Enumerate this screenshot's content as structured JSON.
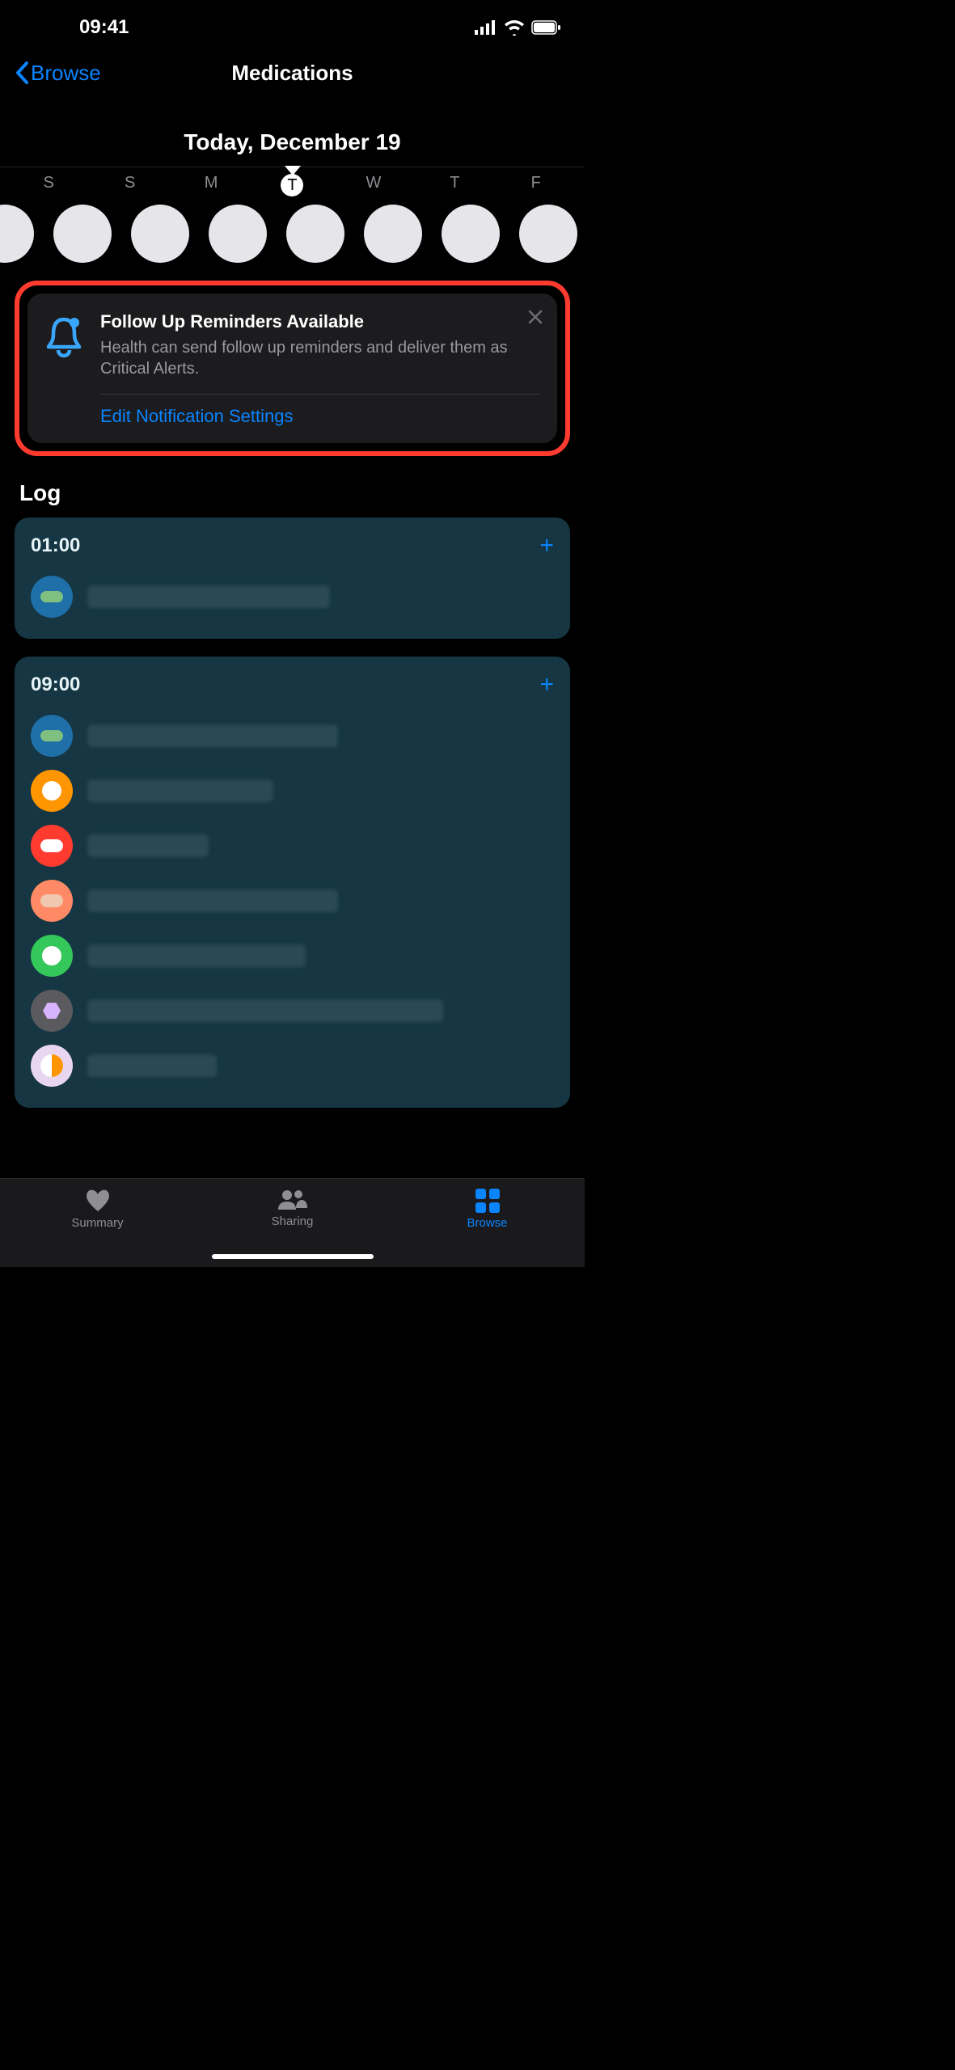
{
  "statusBar": {
    "time": "09:41"
  },
  "nav": {
    "back": "Browse",
    "title": "Medications"
  },
  "dateHeader": "Today, December 19",
  "week": {
    "labels": [
      "S",
      "S",
      "M",
      "T",
      "W",
      "T",
      "F"
    ],
    "selectedIndex": 3
  },
  "notification": {
    "title": "Follow Up Reminders Available",
    "desc": "Health can send follow up reminders and deliver them as Critical Alerts.",
    "link": "Edit Notification Settings"
  },
  "logHeading": "Log",
  "logs": [
    {
      "time": "01:00",
      "meds": [
        {
          "bg": "#1f6fa8",
          "pill": "capsule",
          "pillColor": "#7fbf7f",
          "textWidth": 300
        }
      ]
    },
    {
      "time": "09:00",
      "meds": [
        {
          "bg": "#1f6fa8",
          "pill": "capsule",
          "pillColor": "#7fbf7f",
          "textWidth": 310
        },
        {
          "bg": "#ff9500",
          "pill": "round",
          "pillColor": "#ffffff",
          "textWidth": 230
        },
        {
          "bg": "#ff3b30",
          "pill": "oval",
          "pillColor": "#ffffff",
          "textWidth": 150
        },
        {
          "bg": "#ff8a65",
          "pill": "oval",
          "pillColor": "#f0c8b0",
          "textWidth": 310
        },
        {
          "bg": "#34c759",
          "pill": "round",
          "pillColor": "#ffffff",
          "textWidth": 270
        },
        {
          "bg": "#5a5a5f",
          "pill": "hex",
          "pillColor": "#d8b4fe",
          "textWidth": 440
        },
        {
          "bg": "#e8d5f0",
          "pill": "half",
          "pillColor": "",
          "textWidth": 160
        }
      ]
    }
  ],
  "tabs": {
    "summary": "Summary",
    "sharing": "Sharing",
    "browse": "Browse"
  }
}
